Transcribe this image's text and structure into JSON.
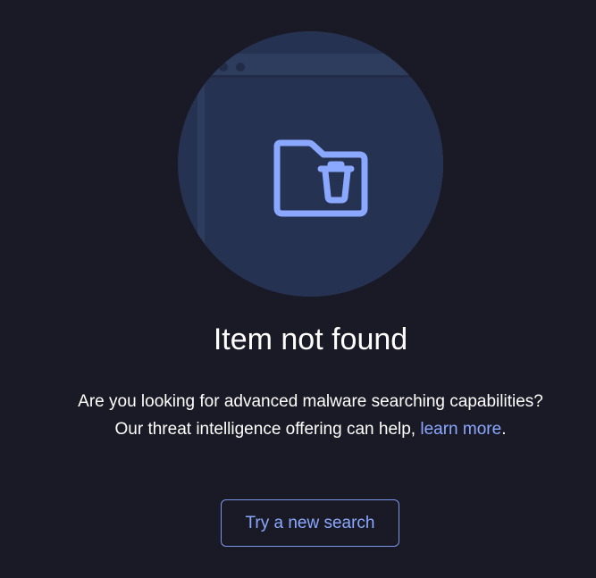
{
  "empty_state": {
    "illustration_icon": "folder-delete-icon",
    "title": "Item not found",
    "message_line1": "Are you looking for advanced malware searching capabilities?",
    "message_line2_prefix": "Our threat intelligence offering can help,",
    "learn_more_link": "learn more",
    "message_line2_suffix": ".",
    "cta_button": "Try a new search"
  },
  "colors": {
    "background": "#1a1a26",
    "circle": "#263251",
    "accent": "#8aa8ff"
  }
}
